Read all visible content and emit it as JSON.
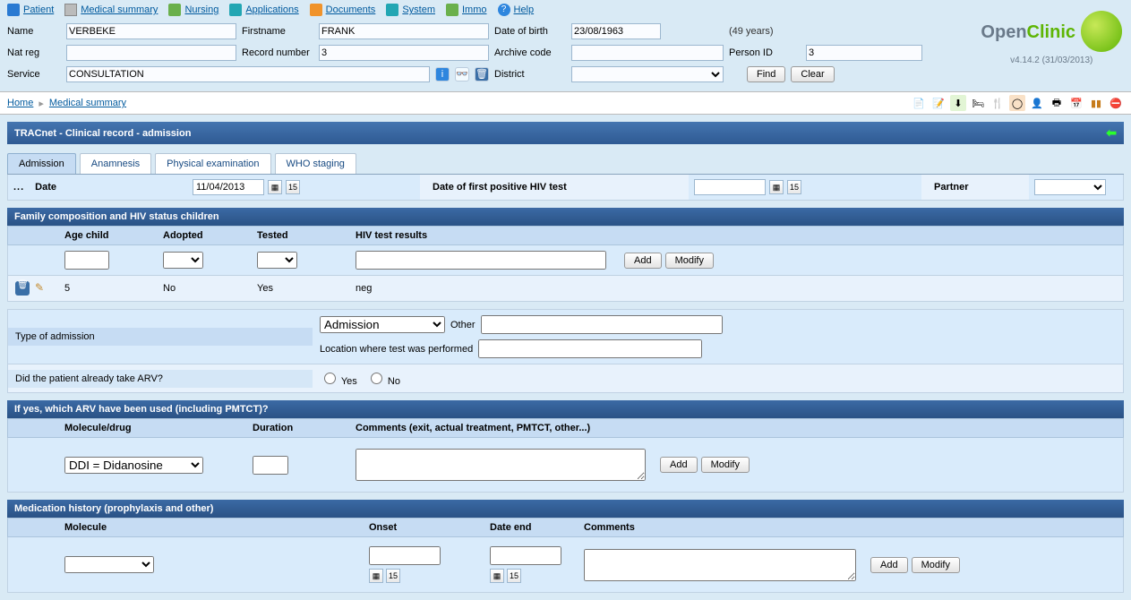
{
  "menu": {
    "patient": "Patient",
    "medical_summary": "Medical summary",
    "nursing": "Nursing",
    "applications": "Applications",
    "documents": "Documents",
    "system": "System",
    "immo": "Immo",
    "help": "Help"
  },
  "patient": {
    "labels": {
      "name": "Name",
      "firstname": "Firstname",
      "dob": "Date of birth",
      "natreg": "Nat reg",
      "recordnum": "Record number",
      "archive": "Archive code",
      "personid": "Person ID",
      "service": "Service",
      "district": "District"
    },
    "name": "VERBEKE",
    "firstname": "FRANK",
    "dob": "23/08/1963",
    "age": "(49 years)",
    "natreg": "",
    "recordnum": "3",
    "archive": "",
    "personid": "3",
    "service": "CONSULTATION",
    "district": "",
    "buttons": {
      "find": "Find",
      "clear": "Clear"
    }
  },
  "logo": {
    "brand_a": "Open",
    "brand_b": "Clinic",
    "version": "v4.14.2 (31/03/2013)"
  },
  "breadcrumb": {
    "home": "Home",
    "medical_summary": "Medical summary"
  },
  "panel": {
    "title": "TRACnet - Clinical record - admission"
  },
  "tabs": {
    "admission": "Admission",
    "anamnesis": "Anamnesis",
    "physical": "Physical examination",
    "who": "WHO staging"
  },
  "admission_form": {
    "date_label": "Date",
    "date_value": "11/04/2013",
    "first_hiv_label": "Date of first positive HIV test",
    "first_hiv_value": "",
    "partner_label": "Partner",
    "dots": "..."
  },
  "family": {
    "section_title": "Family composition and HIV status children",
    "headers": {
      "age": "Age child",
      "adopted": "Adopted",
      "tested": "Tested",
      "results": "HIV test results"
    },
    "row": {
      "age": "5",
      "adopted": "No",
      "tested": "Yes",
      "results": "neg"
    },
    "buttons": {
      "add": "Add",
      "modify": "Modify"
    }
  },
  "admission_type": {
    "label": "Type of admission",
    "select_value": "Admission",
    "other_label": "Other",
    "location_label": "Location where test was performed",
    "arv_label": "Did the patient already take ARV?",
    "yes": "Yes",
    "no": "No"
  },
  "arv": {
    "section_title": "If yes, which ARV have been used (including PMTCT)?",
    "headers": {
      "molecule": "Molecule/drug",
      "duration": "Duration",
      "comments": "Comments (exit, actual treatment, PMTCT, other...)"
    },
    "molecule_value": "DDI = Didanosine",
    "buttons": {
      "add": "Add",
      "modify": "Modify"
    }
  },
  "medhist": {
    "section_title": "Medication history (prophylaxis and other)",
    "headers": {
      "molecule": "Molecule",
      "onset": "Onset",
      "end": "Date end",
      "comments": "Comments"
    },
    "buttons": {
      "add": "Add",
      "modify": "Modify"
    }
  }
}
